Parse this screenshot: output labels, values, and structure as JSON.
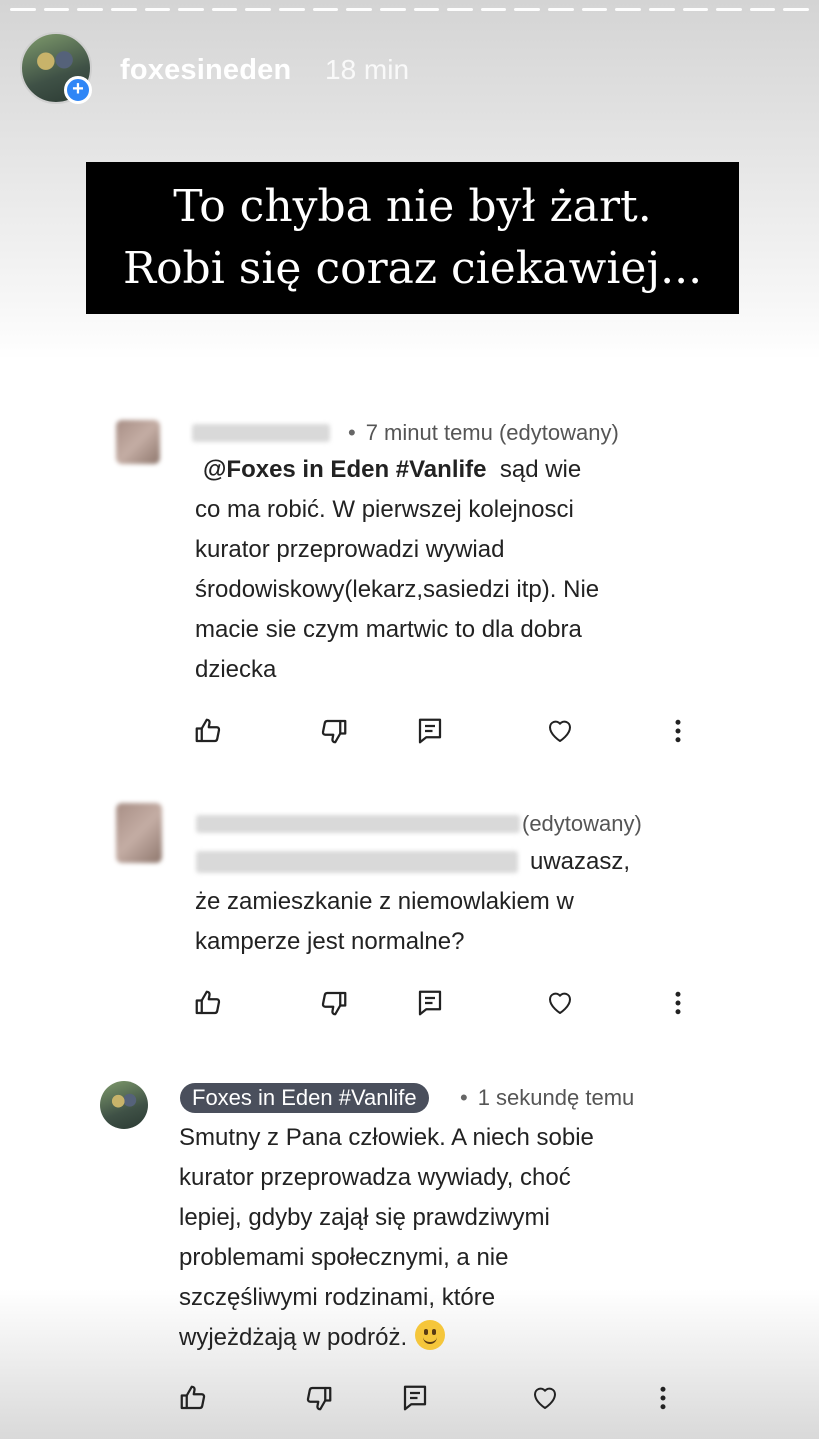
{
  "story": {
    "username": "foxesineden",
    "time": "18 min",
    "add_badge": "+",
    "caption_lines": [
      "To chyba nie był żart.",
      "Robi się coraz ciekawiej..."
    ]
  },
  "comments": [
    {
      "meta": "7 minut temu (edytowany)",
      "mention": "@Foxes in Eden #Vanlife",
      "lines": [
        "sąd wie",
        "co ma robić. W pierwszej kolejnosci",
        "kurator przeprowadzi  wywiad",
        "środowiskowy(lekarz,sasiedzi itp). Nie",
        "macie sie czym martwic to dla dobra",
        "dziecka"
      ]
    },
    {
      "meta": "(edytowany)",
      "lines": [
        "uwazasz,",
        "że zamieszkanie z niemowlakiem w",
        "kamperze jest normalne?"
      ]
    },
    {
      "author": "Foxes in Eden #Vanlife",
      "meta": "1 sekundę temu",
      "lines": [
        "Smutny z Pana człowiek. A niech sobie",
        "kurator przeprowadza wywiady, choć",
        "lepiej, gdyby zajął się prawdziwymi",
        "problemami społecznymi, a nie",
        "szczęśliwymi rodzinami, które",
        "wyjeżdżają w podróż."
      ]
    }
  ],
  "icons": [
    "like-icon",
    "dislike-icon",
    "reply-icon",
    "heart-icon",
    "more-icon"
  ]
}
